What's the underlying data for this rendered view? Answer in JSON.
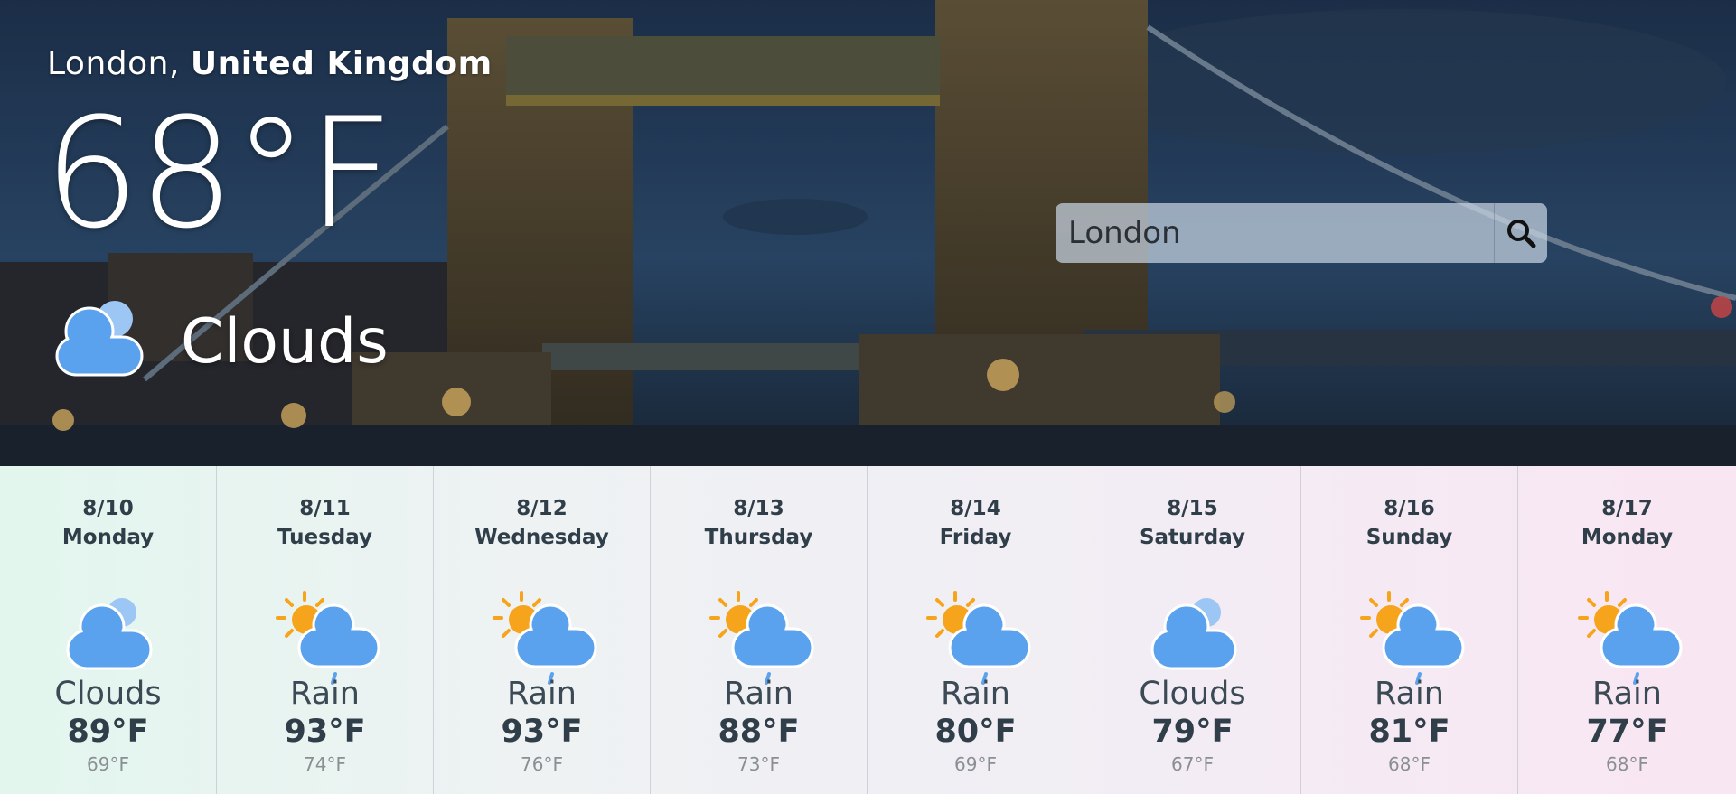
{
  "current": {
    "city": "London,",
    "country": "United Kingdom",
    "temperature": "68°F",
    "condition": "Clouds",
    "condition_icon": "clouds-icon"
  },
  "search": {
    "value": "London",
    "icon": "search-icon"
  },
  "forecast": [
    {
      "date": "8/10",
      "day": "Monday",
      "condition": "Clouds",
      "high": "89°F",
      "low": "69°F",
      "icon": "clouds-icon"
    },
    {
      "date": "8/11",
      "day": "Tuesday",
      "condition": "Rain",
      "high": "93°F",
      "low": "74°F",
      "icon": "sun-rain-icon"
    },
    {
      "date": "8/12",
      "day": "Wednesday",
      "condition": "Rain",
      "high": "93°F",
      "low": "76°F",
      "icon": "sun-rain-icon"
    },
    {
      "date": "8/13",
      "day": "Thursday",
      "condition": "Rain",
      "high": "88°F",
      "low": "73°F",
      "icon": "sun-rain-icon"
    },
    {
      "date": "8/14",
      "day": "Friday",
      "condition": "Rain",
      "high": "80°F",
      "low": "69°F",
      "icon": "sun-rain-icon"
    },
    {
      "date": "8/15",
      "day": "Saturday",
      "condition": "Clouds",
      "high": "79°F",
      "low": "67°F",
      "icon": "clouds-icon"
    },
    {
      "date": "8/16",
      "day": "Sunday",
      "condition": "Rain",
      "high": "81°F",
      "low": "68°F",
      "icon": "sun-rain-icon"
    },
    {
      "date": "8/17",
      "day": "Monday",
      "condition": "Rain",
      "high": "77°F",
      "low": "68°F",
      "icon": "sun-rain-icon"
    }
  ],
  "colors": {
    "cloud": "#5aa2ee",
    "cloud_back": "#9cc6f3",
    "sun": "#f6a41c",
    "rain": "#5aa2ee"
  }
}
